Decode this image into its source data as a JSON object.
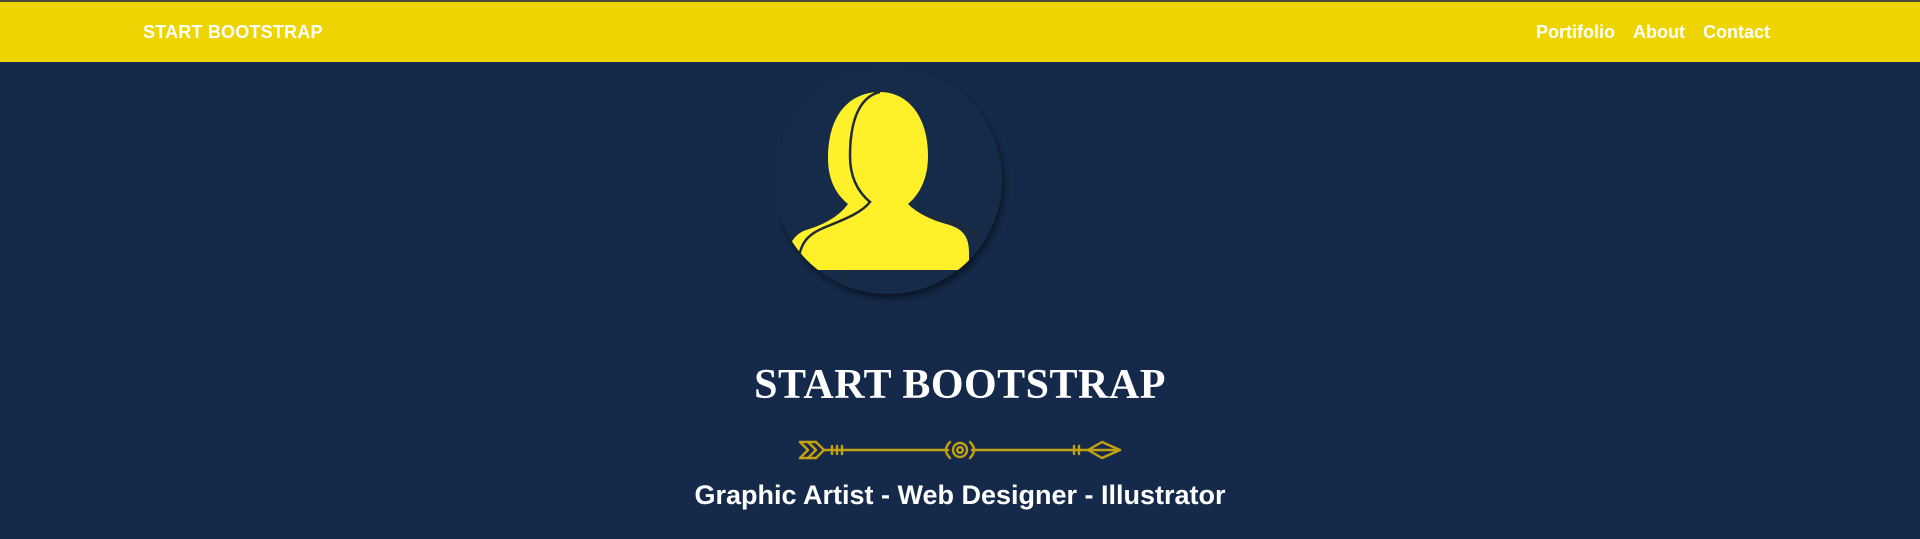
{
  "navbar": {
    "brand": "START BOOTSTRAP",
    "links": [
      {
        "label": "Portifolio"
      },
      {
        "label": "About"
      },
      {
        "label": "Contact"
      }
    ],
    "background_color": "#eed502"
  },
  "hero": {
    "avatar_icon": "user-silhouette-icon",
    "title": "START BOOTSTRAP",
    "divider_icon": "arrow-divider-icon",
    "subtitle": "Graphic Artist - Web Designer - Illustrator",
    "background_color": "#152a4a",
    "accent_color": "#fff02a"
  }
}
